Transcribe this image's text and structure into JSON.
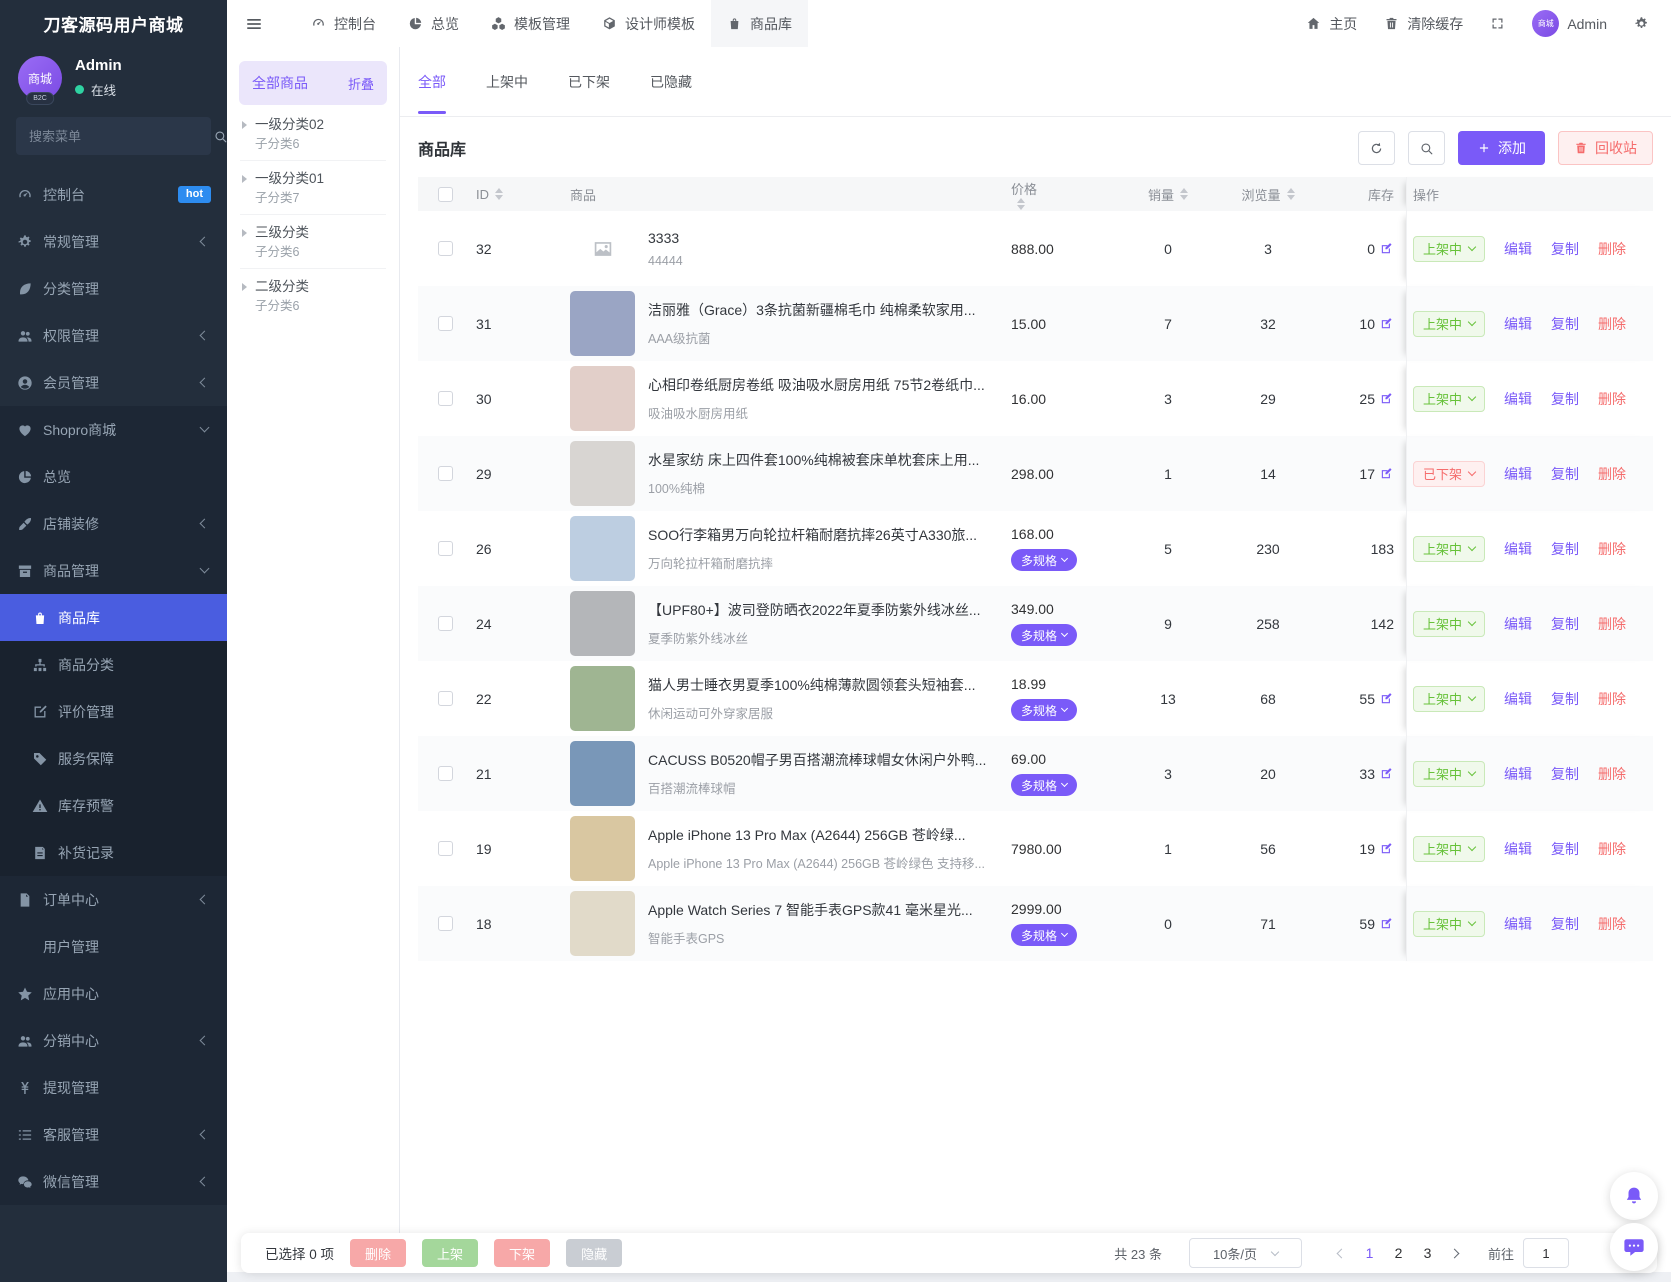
{
  "colors": {
    "accent": "#7a5af8",
    "sidebar_active": "#4a5de0",
    "success": "#67c23a",
    "danger": "#f56c6c",
    "hot_badge": "#2d8cf0",
    "online": "#2fd2a2"
  },
  "app": {
    "title": "刀客源码用户商城"
  },
  "user": {
    "avatar_text": "商城",
    "avatar_badge": "B2C",
    "name": "Admin",
    "status": "在线"
  },
  "sidebar": {
    "search_placeholder": "搜索菜单",
    "items": [
      {
        "label": "控制台",
        "icon": "gauge",
        "badge": "hot"
      },
      {
        "label": "常规管理",
        "icon": "gear",
        "chevron": "left"
      },
      {
        "label": "分类管理",
        "icon": "leaf"
      },
      {
        "label": "权限管理",
        "icon": "users",
        "chevron": "left"
      },
      {
        "label": "会员管理",
        "icon": "user-circle",
        "chevron": "left"
      },
      {
        "label": "Shopro商城",
        "icon": "heart",
        "chevron": "down",
        "group": 1
      },
      {
        "label": "总览",
        "icon": "pie",
        "group": 1
      },
      {
        "label": "店铺装修",
        "icon": "brush",
        "chevron": "left",
        "group": 1
      },
      {
        "label": "商品管理",
        "icon": "archive",
        "chevron": "down",
        "group": 1
      },
      {
        "label": "商品库",
        "icon": "bag",
        "group": 2,
        "level": 3,
        "active": true
      },
      {
        "label": "商品分类",
        "icon": "sitemap",
        "group": 2,
        "level": 3
      },
      {
        "label": "评价管理",
        "icon": "pen-square",
        "group": 2,
        "level": 3
      },
      {
        "label": "服务保障",
        "icon": "tag",
        "group": 2,
        "level": 3
      },
      {
        "label": "库存预警",
        "icon": "warning",
        "group": 2,
        "level": 3
      },
      {
        "label": "补货记录",
        "icon": "note",
        "group": 2,
        "level": 3
      },
      {
        "label": "订单中心",
        "icon": "file",
        "chevron": "left",
        "group": 1
      },
      {
        "label": "用户管理",
        "icon": "user",
        "group": 1
      },
      {
        "label": "应用中心",
        "icon": "star",
        "group": 1
      },
      {
        "label": "分销中心",
        "icon": "users",
        "chevron": "left",
        "group": 1
      },
      {
        "label": "提现管理",
        "icon": "yen",
        "group": 1
      },
      {
        "label": "客服管理",
        "icon": "list",
        "chevron": "left",
        "group": 1
      },
      {
        "label": "微信管理",
        "icon": "wechat",
        "chevron": "left",
        "group": 1
      }
    ]
  },
  "topbar": {
    "tabs": [
      {
        "label": "控制台",
        "icon": "gauge"
      },
      {
        "label": "总览",
        "icon": "pie"
      },
      {
        "label": "模板管理",
        "icon": "cubes"
      },
      {
        "label": "设计师模板",
        "icon": "box"
      },
      {
        "label": "商品库",
        "icon": "bag",
        "active": true
      }
    ],
    "home_label": "主页",
    "clear_cache_label": "清除缓存",
    "admin_name": "Admin"
  },
  "category_panel": {
    "title": "全部商品",
    "collapse_label": "折叠",
    "items": [
      {
        "name": "一级分类02",
        "sub": "子分类6"
      },
      {
        "name": "一级分类01",
        "sub": "子分类7"
      },
      {
        "name": "三级分类",
        "sub": "子分类6"
      },
      {
        "name": "二级分类",
        "sub": "子分类6"
      }
    ]
  },
  "main": {
    "tabs": [
      {
        "label": "全部",
        "active": true
      },
      {
        "label": "上架中"
      },
      {
        "label": "已下架"
      },
      {
        "label": "已隐藏"
      }
    ],
    "section_title": "商品库",
    "add_label": "添加",
    "recycle_label": "回收站",
    "table": {
      "columns": [
        {
          "label": "ID",
          "sortable": true
        },
        {
          "label": "商品",
          "sortable": false
        },
        {
          "label": "价格",
          "sortable": true
        },
        {
          "label": "销量",
          "sortable": true
        },
        {
          "label": "浏览量",
          "sortable": true
        },
        {
          "label": "库存",
          "sortable": false
        },
        {
          "label": "操作",
          "sortable": false
        }
      ],
      "multi_spec_label": "多规格",
      "status_labels": {
        "on": "上架中",
        "off": "已下架"
      },
      "action_labels": [
        "编辑",
        "复制",
        "删除"
      ],
      "rows": [
        {
          "id": "32",
          "title": "3333",
          "subtitle": "44444",
          "image_color": null,
          "price": "888.00",
          "multi_spec": false,
          "sales": "0",
          "views": "3",
          "stock": "0",
          "stock_edit": true,
          "status": "on"
        },
        {
          "id": "31",
          "title": "洁丽雅（Grace）3条抗菌新疆棉毛巾 纯棉柔软家用...",
          "subtitle": "AAA级抗菌",
          "image_color": "#9aa5c4",
          "price": "15.00",
          "multi_spec": false,
          "sales": "7",
          "views": "32",
          "stock": "10",
          "stock_edit": true,
          "status": "on"
        },
        {
          "id": "30",
          "title": "心相印卷纸厨房卷纸 吸油吸水厨房用纸 75节2卷纸巾...",
          "subtitle": "吸油吸水厨房用纸",
          "image_color": "#e2cfc9",
          "price": "16.00",
          "multi_spec": false,
          "sales": "3",
          "views": "29",
          "stock": "25",
          "stock_edit": true,
          "status": "on"
        },
        {
          "id": "29",
          "title": "水星家纺 床上四件套100%纯棉被套床单枕套床上用...",
          "subtitle": "100%纯棉",
          "image_color": "#d8d5d2",
          "price": "298.00",
          "multi_spec": false,
          "sales": "1",
          "views": "14",
          "stock": "17",
          "stock_edit": true,
          "status": "off"
        },
        {
          "id": "26",
          "title": "SOO行李箱男万向轮拉杆箱耐磨抗摔26英寸A330旅...",
          "subtitle": "万向轮拉杆箱耐磨抗摔",
          "image_color": "#bdcee1",
          "price": "168.00",
          "multi_spec": true,
          "sales": "5",
          "views": "230",
          "stock": "183",
          "stock_edit": false,
          "status": "on"
        },
        {
          "id": "24",
          "title": "【UPF80+】波司登防晒衣2022年夏季防紫外线冰丝...",
          "subtitle": "夏季防紫外线冰丝",
          "image_color": "#b4b6b9",
          "price": "349.00",
          "multi_spec": true,
          "sales": "9",
          "views": "258",
          "stock": "142",
          "stock_edit": false,
          "status": "on"
        },
        {
          "id": "22",
          "title": "猫人男士睡衣男夏季100%纯棉薄款圆领套头短袖套...",
          "subtitle": "休闲运动可外穿家居服",
          "image_color": "#9fb592",
          "price": "18.99",
          "multi_spec": true,
          "sales": "13",
          "views": "68",
          "stock": "55",
          "stock_edit": true,
          "status": "on"
        },
        {
          "id": "21",
          "title": "CACUSS B0520帽子男百搭潮流棒球帽女休闲户外鸭...",
          "subtitle": "百搭潮流棒球帽",
          "image_color": "#7997b8",
          "price": "69.00",
          "multi_spec": true,
          "sales": "3",
          "views": "20",
          "stock": "33",
          "stock_edit": true,
          "status": "on"
        },
        {
          "id": "19",
          "title": "Apple iPhone 13 Pro Max (A2644) 256GB 苍岭绿...",
          "subtitle": "Apple iPhone 13 Pro Max (A2644) 256GB 苍岭绿色 支持移...",
          "image_color": "#d9c7a1",
          "price": "7980.00",
          "multi_spec": false,
          "sales": "1",
          "views": "56",
          "stock": "19",
          "stock_edit": true,
          "status": "on"
        },
        {
          "id": "18",
          "title": "Apple Watch Series 7 智能手表GPS款41 毫米星光...",
          "subtitle": "智能手表GPS",
          "image_color": "#e1dac9",
          "price": "2999.00",
          "multi_spec": true,
          "sales": "0",
          "views": "71",
          "stock": "59",
          "stock_edit": true,
          "status": "on"
        }
      ]
    }
  },
  "bottom_bar": {
    "selected_text": "已选择 0 项",
    "buttons": [
      {
        "label": "删除",
        "type": "danger"
      },
      {
        "label": "上架",
        "type": "success"
      },
      {
        "label": "下架",
        "type": "danger"
      },
      {
        "label": "隐藏",
        "type": "muted"
      }
    ],
    "pagination": {
      "total_text": "共 23 条",
      "page_size": "10条/页",
      "pages": [
        "1",
        "2",
        "3"
      ],
      "active_page": "1",
      "goto_label": "前往",
      "goto_value": "1"
    }
  }
}
